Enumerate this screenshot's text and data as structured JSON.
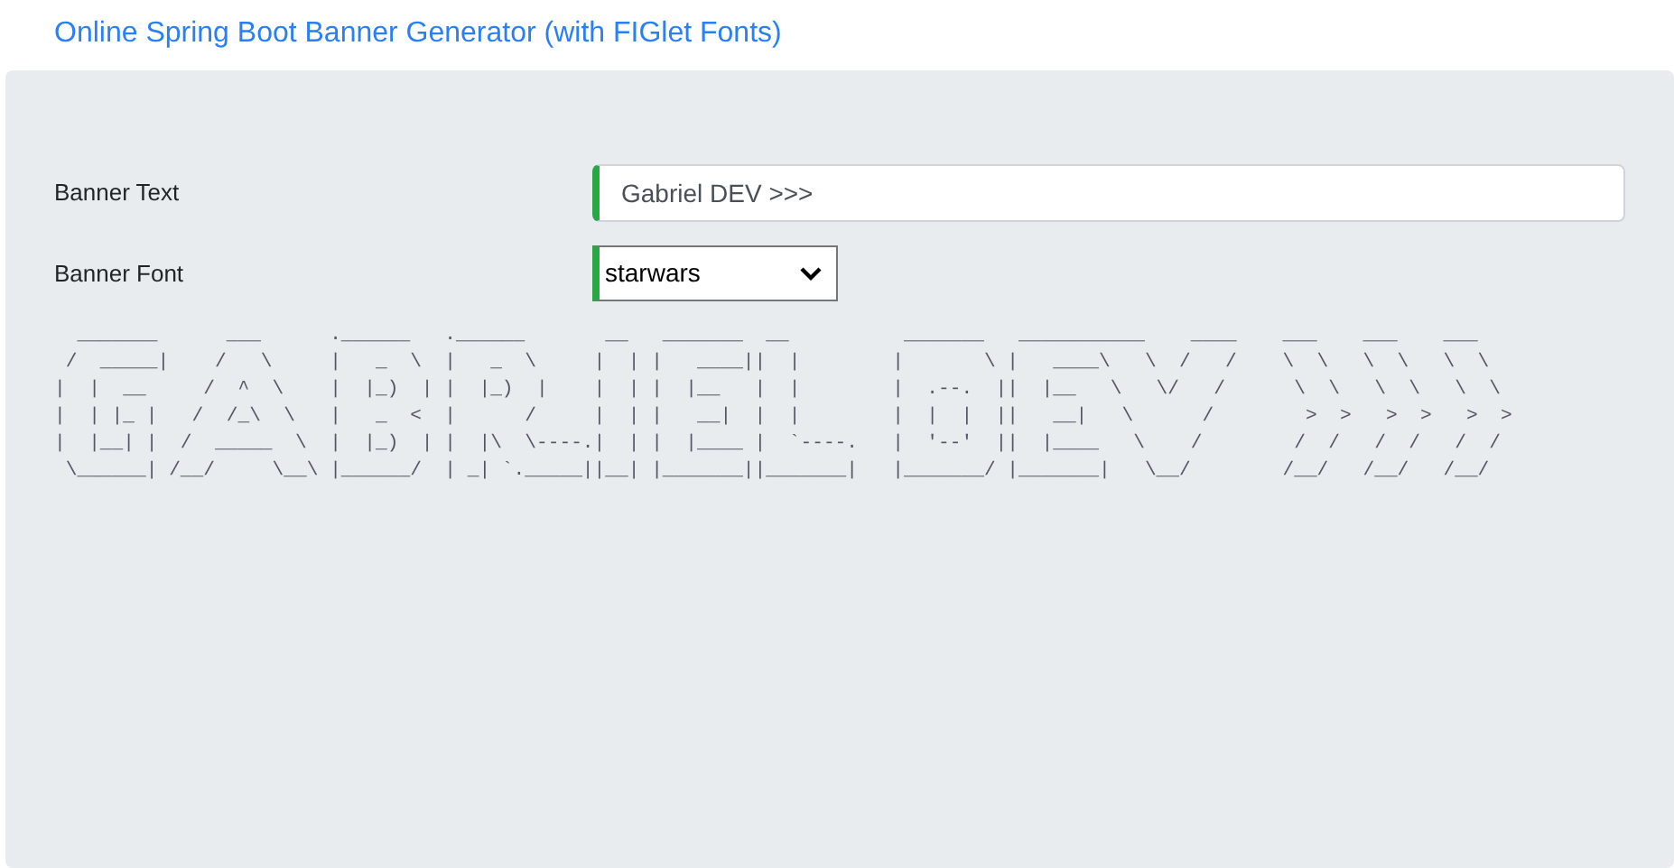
{
  "page_title": "Online Spring Boot Banner Generator (with FIGlet Fonts)",
  "fields": [
    {
      "kind": "text",
      "label": "Banner Text",
      "value": "Gabriel DEV >>>"
    },
    {
      "kind": "select",
      "label": "Banner Font",
      "value": "starwars"
    }
  ],
  "banner_lines": [
    "  _______      ___      .______   .______       __   _______  __          _______   ___________    ____    ___    ___    ___   ",
    " /  _____|    /   \\     |   _  \\  |   _  \\     |  | |   ____||  |        |       \\ |   ____\\   \\  /   /    \\  \\   \\  \\   \\  \\  ",
    "|  |  __     /  ^  \\    |  |_)  | |  |_)  |    |  | |  |__   |  |        |  .--.  ||  |__   \\   \\/   /      \\  \\   \\  \\   \\  \\ ",
    "|  | |_ |   /  /_\\  \\   |   _  <  |      /     |  | |   __|  |  |        |  |  |  ||   __|   \\      /        >  >   >  >   >  >",
    "|  |__| |  /  _____  \\  |  |_)  | |  |\\  \\----.|  | |  |____ |  `----.   |  '--'  ||  |____   \\    /        /  /   /  /   /  / ",
    " \\______| /__/     \\__\\ |______/  | _| `._____||__| |_______||_______|   |_______/ |_______|   \\__/        /__/   /__/   /__/  "
  ]
}
